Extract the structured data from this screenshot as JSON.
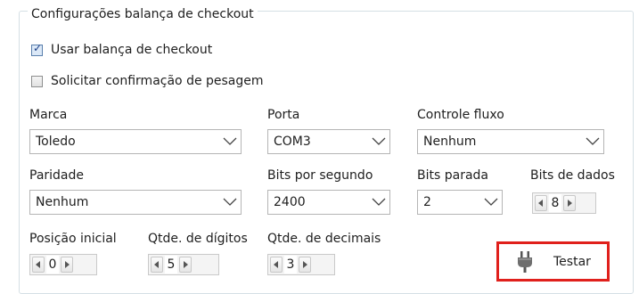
{
  "group": {
    "title": "Configurações balança de checkout"
  },
  "checkboxes": {
    "use_scale": {
      "label": "Usar balança de checkout",
      "checked": true
    },
    "confirm_weighing": {
      "label": "Solicitar confirmação de pesagem",
      "checked": false
    }
  },
  "fields": {
    "marca": {
      "label": "Marca",
      "value": "Toledo"
    },
    "porta": {
      "label": "Porta",
      "value": "COM3"
    },
    "controle_fluxo": {
      "label": "Controle fluxo",
      "value": "Nenhum"
    },
    "paridade": {
      "label": "Paridade",
      "value": "Nenhum"
    },
    "bits_por_segundo": {
      "label": "Bits por segundo",
      "value": "2400"
    },
    "bits_parada": {
      "label": "Bits parada",
      "value": "2"
    },
    "bits_de_dados": {
      "label": "Bits de dados",
      "value": "8"
    },
    "posicao_inicial": {
      "label": "Posição inicial",
      "value": "0"
    },
    "qtde_digitos": {
      "label": "Qtde. de dígitos",
      "value": "5"
    },
    "qtde_decimais": {
      "label": "Qtde. de decimais",
      "value": "3"
    }
  },
  "test_button": {
    "label": "Testar",
    "icon": "plug-icon"
  },
  "colors": {
    "highlight": "#e0201c",
    "check_accent": "#1b3f87"
  }
}
